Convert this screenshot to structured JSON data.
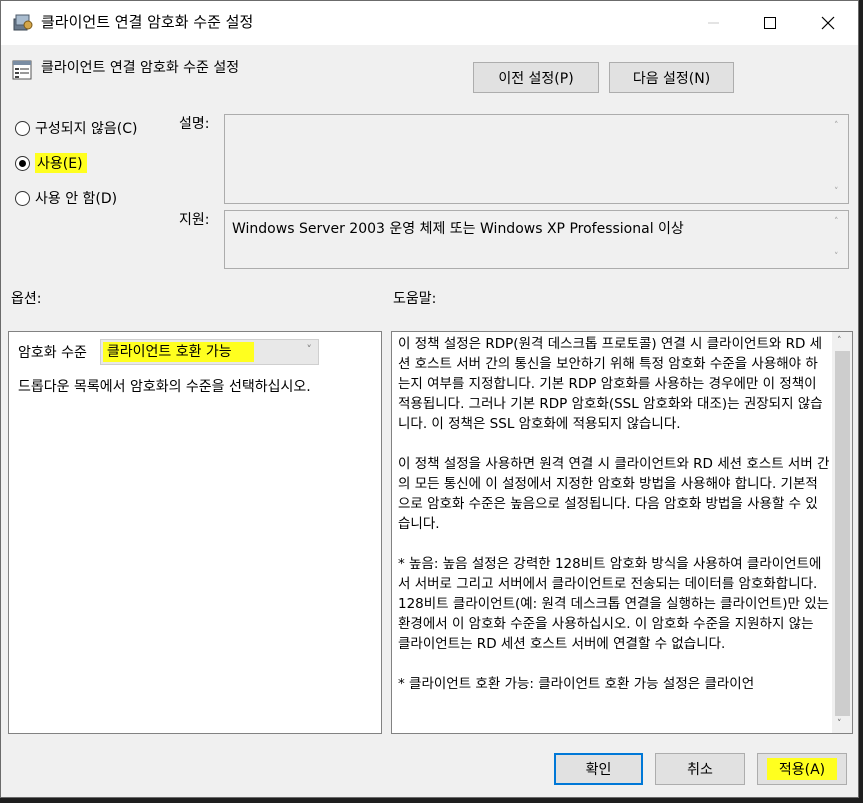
{
  "window": {
    "title": "클라이언트 연결 암호화 수준 설정",
    "controls": {
      "minimize": "minimize",
      "maximize": "maximize",
      "close": "close"
    }
  },
  "header": {
    "setting_title": "클라이언트 연결 암호화 수준 설정",
    "prev_button": "이전 설정(P)",
    "next_button": "다음 설정(N)"
  },
  "state": {
    "options": [
      {
        "label": "구성되지 않음(C)",
        "checked": false
      },
      {
        "label": "사용(E)",
        "checked": true,
        "highlighted": true
      },
      {
        "label": "사용 안 함(D)",
        "checked": false
      }
    ]
  },
  "fields": {
    "description_label": "설명:",
    "description_value": "",
    "support_label": "지원:",
    "support_value": "Windows Server 2003 운영 체제 또는 Windows XP Professional 이상"
  },
  "options_panel": {
    "label": "옵션:",
    "encryption_level_label": "암호화 수준",
    "encryption_level_value": "클라이언트 호환 가능",
    "hint": "드롭다운 목록에서 암호화의 수준을 선택하십시오."
  },
  "help_panel": {
    "label": "도움말:",
    "paragraphs": [
      "이 정책 설정은 RDP(원격 데스크톱 프로토콜) 연결 시 클라이언트와 RD 세션 호스트 서버 간의 통신을 보안하기 위해 특정 암호화 수준을 사용해야 하는지 여부를 지정합니다. 기본 RDP 암호화를 사용하는 경우에만 이 정책이 적용됩니다. 그러나 기본 RDP 암호화(SSL 암호화와 대조)는 권장되지 않습니다. 이 정책은 SSL 암호화에 적용되지 않습니다.",
      "이 정책 설정을 사용하면 원격 연결 시 클라이언트와 RD 세션 호스트 서버 간의 모든 통신에 이 설정에서 지정한 암호화 방법을 사용해야 합니다. 기본적으로 암호화 수준은 높음으로 설정됩니다. 다음 암호화 방법을 사용할 수 있습니다.",
      "* 높음: 높음 설정은 강력한 128비트 암호화 방식을 사용하여 클라이언트에서 서버로 그리고 서버에서 클라이언트로 전송되는 데이터를 암호화합니다. 128비트 클라이언트(예: 원격 데스크톱 연결을 실행하는 클라이언트)만 있는 환경에서 이 암호화 수준을 사용하십시오. 이 암호화 수준을 지원하지 않는 클라이언트는 RD 세션 호스트 서버에 연결할 수 없습니다.",
      "* 클라이언트 호환 가능: 클라이언트 호환 가능 설정은 클라이언"
    ]
  },
  "footer": {
    "ok": "확인",
    "cancel": "취소",
    "apply": "적용(A)"
  },
  "colors": {
    "highlight": "#ffff1f",
    "dialog_bg": "#f0f0f0",
    "default_button_border": "#0078d7"
  }
}
